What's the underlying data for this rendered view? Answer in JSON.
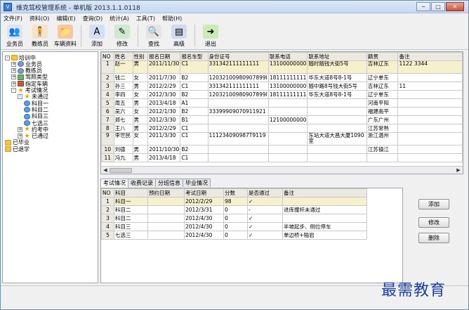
{
  "window": {
    "title": "维克驾校管理系统 - 单机版 2013.1.1.0118",
    "controls": [
      "─",
      "□",
      "✕"
    ]
  },
  "menu": [
    "文件(F)",
    "资料(O)",
    "编辑(E)",
    "查询(D)",
    "统计(A)",
    "工具(T)",
    "帮助(H)"
  ],
  "toolbar": [
    {
      "label": "业务员",
      "icon": "salesperson-icon",
      "glyph": "👥",
      "bg": "#d9e6f5"
    },
    {
      "label": "教练员",
      "icon": "coach-icon",
      "glyph": "🧍",
      "bg": "#f5e3c9"
    },
    {
      "label": "车辆资料",
      "icon": "vehicle-folder-icon",
      "glyph": "📁",
      "bg": "#f7c6a4"
    },
    {
      "label": "添加",
      "icon": "add-icon",
      "glyph": "A",
      "bg": "#cfe0f7"
    },
    {
      "label": "修改",
      "icon": "edit-icon",
      "glyph": "✎",
      "bg": "#cfe8d0"
    },
    {
      "label": "查找",
      "icon": "search-icon",
      "glyph": "🔍",
      "bg": "#e4e4e4"
    },
    {
      "label": "高级",
      "icon": "advanced-icon",
      "glyph": "▤",
      "bg": "#d5d9f0"
    },
    {
      "label": "退出",
      "icon": "exit-icon",
      "glyph": "➜",
      "bg": "#c7ecb5"
    }
  ],
  "tree": [
    {
      "label": "培训中",
      "icon": "folder",
      "level": 0,
      "exp": "-"
    },
    {
      "label": "业务员",
      "icon": "person",
      "level": 1,
      "exp": "+"
    },
    {
      "label": "教练员",
      "icon": "person",
      "level": 1,
      "exp": "+"
    },
    {
      "label": "驾照类型",
      "icon": "type",
      "level": 1,
      "exp": "+"
    },
    {
      "label": "指定车辆",
      "icon": "car",
      "level": 1,
      "exp": "+"
    },
    {
      "label": "考试情况",
      "icon": "star",
      "level": 1,
      "exp": "-"
    },
    {
      "label": "未通过",
      "icon": "star",
      "level": 2,
      "exp": "-"
    },
    {
      "label": "科目一",
      "icon": "globe",
      "level": 3,
      "exp": ""
    },
    {
      "label": "科目二",
      "icon": "globe",
      "level": 3,
      "exp": ""
    },
    {
      "label": "科目三",
      "icon": "globe",
      "level": 3,
      "exp": ""
    },
    {
      "label": "七选三",
      "icon": "globe",
      "level": 3,
      "exp": ""
    },
    {
      "label": "约考中",
      "icon": "star",
      "level": 2,
      "exp": "+"
    },
    {
      "label": "已通过",
      "icon": "star",
      "level": 2,
      "exp": "+"
    },
    {
      "label": "已毕业",
      "icon": "folder",
      "level": 0,
      "exp": ""
    },
    {
      "label": "已退学",
      "icon": "folder",
      "level": 0,
      "exp": ""
    }
  ],
  "students": {
    "columns": [
      "NO",
      "姓名",
      "性别",
      "报名日期",
      "报名车型",
      "身份证号",
      "联系电话",
      "联系地址",
      "籍贯",
      "备注"
    ],
    "rows": [
      [
        "1",
        "赵一",
        "男",
        "2011/11/30",
        "C1",
        "331342111111111",
        "13100000000",
        "随时随钱大街5号",
        "吉林辽东",
        "1122 3344"
      ],
      [
        "2",
        "钱二",
        "女",
        "2011/7/30",
        "B2",
        "12032100980907899I",
        "18111111111",
        "华东大道8号8-1号",
        "辽宁单东",
        ""
      ],
      [
        "3",
        "孙三",
        "男",
        "2012/2/29",
        "C1",
        "331342111111111",
        "13100000000",
        "随中路8号钱大街5号",
        "吉林辽东",
        "11"
      ],
      [
        "4",
        "李四",
        "女",
        "2012/3/30",
        "B2",
        "12032100980907899I",
        "18111111111",
        "华东大道8号8-1号",
        "辽宁单东",
        ""
      ],
      [
        "5",
        "周五",
        "男",
        "2013/4/18",
        "A1",
        "",
        "",
        "",
        "河南平阳",
        ""
      ],
      [
        "6",
        "吴六",
        "女",
        "2012/1/30",
        "B2",
        "33399909070911921",
        "",
        "",
        "福建南平",
        ""
      ],
      [
        "7",
        "郑七",
        "男",
        "2012/3/30",
        "B1",
        "",
        "12100000000",
        "",
        "广东广州",
        ""
      ],
      [
        "8",
        "王八",
        "男",
        "2012/2/29",
        "C1",
        "",
        "",
        "",
        "江苏常熟",
        ""
      ],
      [
        "9",
        "李世民",
        "女",
        "2011/3/30",
        "C1",
        "111234090987T9119",
        "",
        "东站大道大昌大厦1090室",
        "浙江温州",
        ""
      ],
      [
        "10",
        "刘德",
        "男",
        "2011/10/30",
        "B2",
        "",
        "",
        "",
        "江苏镇江",
        ""
      ],
      [
        "11",
        "冯九",
        "男",
        "2013/4/18",
        "C1",
        "",
        "",
        "",
        "",
        ""
      ]
    ]
  },
  "tabs": [
    "考试情况",
    "收费记录",
    "分班信息",
    "毕业情况"
  ],
  "exams": {
    "columns": [
      "NO",
      "科目",
      "预约日期",
      "考试日期",
      "分数",
      "是否通过",
      "备注"
    ],
    "rows": [
      [
        "1",
        "科目一",
        "",
        "2012/2/29",
        "98",
        "✓",
        ""
      ],
      [
        "2",
        "科目二",
        "",
        "2012/3/31",
        "0",
        "-",
        "进库撞杆未通过"
      ],
      [
        "3",
        "科目二",
        "",
        "2012/4/30",
        "0",
        "✓",
        ""
      ],
      [
        "4",
        "科目三",
        "",
        "2012/4/30",
        "0",
        "✓",
        "半坡起步、侧位停车"
      ],
      [
        "5",
        "七选三",
        "",
        "2012/4/30",
        "0",
        "✓",
        "单边桥+隘岩"
      ]
    ]
  },
  "side_buttons": [
    "添加",
    "修改",
    "删除"
  ],
  "watermark": "最需教育"
}
